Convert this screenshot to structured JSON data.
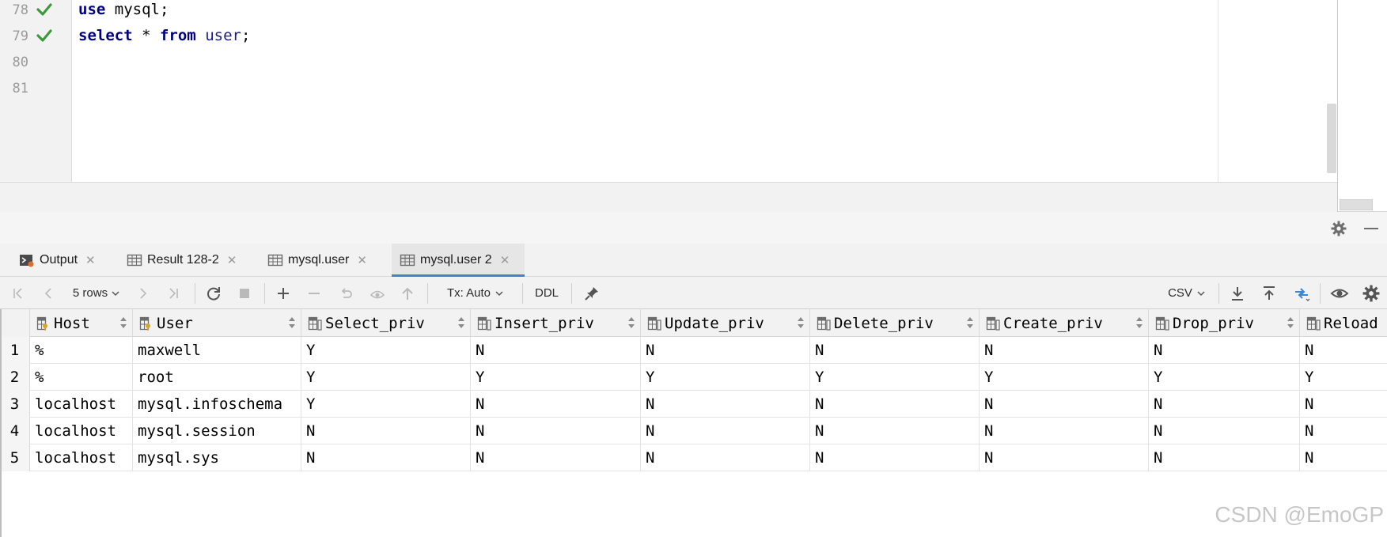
{
  "editor": {
    "lines": [
      {
        "num": "78",
        "status": "check-icon",
        "tokens": [
          {
            "t": "use",
            "kind": "kw"
          },
          {
            "t": " mysql;",
            "kind": "plain"
          }
        ]
      },
      {
        "num": "79",
        "status": "check-icon",
        "tokens": [
          {
            "t": "select",
            "kind": "kw"
          },
          {
            "t": " * ",
            "kind": "plain"
          },
          {
            "t": "from",
            "kind": "kw"
          },
          {
            "t": " ",
            "kind": "plain"
          },
          {
            "t": "user",
            "kind": "tbl"
          },
          {
            "t": ";",
            "kind": "plain"
          }
        ]
      },
      {
        "num": "80",
        "status": "",
        "tokens": []
      },
      {
        "num": "81",
        "status": "",
        "tokens": []
      }
    ]
  },
  "tabs": [
    {
      "label": "Output",
      "icon": "console-icon",
      "active": false
    },
    {
      "label": "Result 128-2",
      "icon": "table-icon",
      "active": false
    },
    {
      "label": "mysql.user",
      "icon": "table-icon",
      "active": false
    },
    {
      "label": "mysql.user 2",
      "icon": "table-icon",
      "active": true
    }
  ],
  "toolbar": {
    "rows_label": "5 rows",
    "tx_label": "Tx: Auto",
    "ddl_label": "DDL",
    "export_label": "CSV"
  },
  "grid": {
    "columns": [
      {
        "name": "Host",
        "icon": "key-column-icon"
      },
      {
        "name": "User",
        "icon": "key-column-icon"
      },
      {
        "name": "Select_priv",
        "icon": "column-icon"
      },
      {
        "name": "Insert_priv",
        "icon": "column-icon"
      },
      {
        "name": "Update_priv",
        "icon": "column-icon"
      },
      {
        "name": "Delete_priv",
        "icon": "column-icon"
      },
      {
        "name": "Create_priv",
        "icon": "column-icon"
      },
      {
        "name": "Drop_priv",
        "icon": "column-icon"
      },
      {
        "name": "Reload",
        "icon": "column-icon"
      }
    ],
    "rows": [
      {
        "num": "1",
        "cells": [
          "%",
          "maxwell",
          "Y",
          "N",
          "N",
          "N",
          "N",
          "N",
          "N"
        ]
      },
      {
        "num": "2",
        "cells": [
          "%",
          "root",
          "Y",
          "Y",
          "Y",
          "Y",
          "Y",
          "Y",
          "Y"
        ]
      },
      {
        "num": "3",
        "cells": [
          "localhost",
          "mysql.infoschema",
          "Y",
          "N",
          "N",
          "N",
          "N",
          "N",
          "N"
        ]
      },
      {
        "num": "4",
        "cells": [
          "localhost",
          "mysql.session",
          "N",
          "N",
          "N",
          "N",
          "N",
          "N",
          "N"
        ]
      },
      {
        "num": "5",
        "cells": [
          "localhost",
          "mysql.sys",
          "N",
          "N",
          "N",
          "N",
          "N",
          "N",
          "N"
        ]
      }
    ]
  },
  "watermark": "CSDN @EmoGP",
  "colors": {
    "keyword": "#000080",
    "accent": "#4083c9",
    "check": "#3c9a3c"
  }
}
